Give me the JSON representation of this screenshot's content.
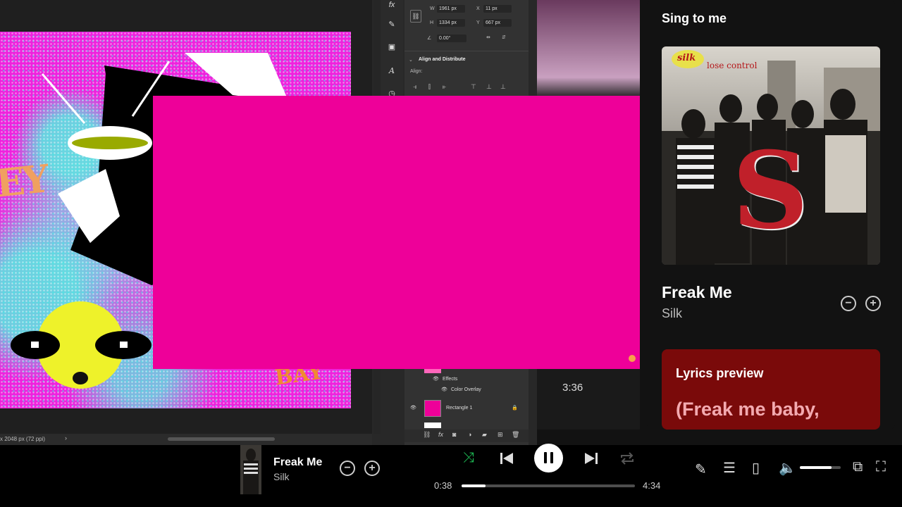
{
  "photoshop": {
    "properties": {
      "w_label": "W",
      "w_value": "1961 px",
      "x_label": "X",
      "x_value": "11 px",
      "h_label": "H",
      "h_value": "1334 px",
      "y_label": "Y",
      "y_value": "667 px",
      "angle_value": "0.00°",
      "section_title": "Align and Distribute",
      "align_label": "Align:"
    },
    "layers": {
      "effects_label": "Effects",
      "color_overlay_label": "Color Overlay",
      "rectangle_layer_label": "Rectangle 1"
    },
    "status": {
      "doc_size": "x 2048 px (72 ppi)"
    },
    "artwork_text_left": "EY",
    "artwork_text_bottom": "BAY"
  },
  "now_playing_panel": {
    "side_time": "3:36",
    "title": "Sing to me",
    "cover_brand": "silk",
    "cover_subtitle": "lose control",
    "cover_letter": "S",
    "track_title": "Freak Me",
    "track_artist": "Silk",
    "lyrics_title": "Lyrics preview",
    "lyrics_line": "(Freak me baby,"
  },
  "player": {
    "track_title": "Freak Me",
    "track_artist": "Silk",
    "elapsed": "0:38",
    "total": "4:34",
    "progress_fraction": 0.14,
    "volume_fraction": 0.78
  },
  "colors": {
    "accent_pink": "#ee0099",
    "spotify_green": "#1db954",
    "lyrics_bg": "#7a0a0a"
  },
  "icons": {
    "remove": "minus-circle-icon",
    "add": "plus-circle-icon",
    "shuffle": "shuffle-icon",
    "previous": "previous-icon",
    "pause": "pause-icon",
    "next": "next-icon",
    "repeat": "repeat-icon"
  }
}
